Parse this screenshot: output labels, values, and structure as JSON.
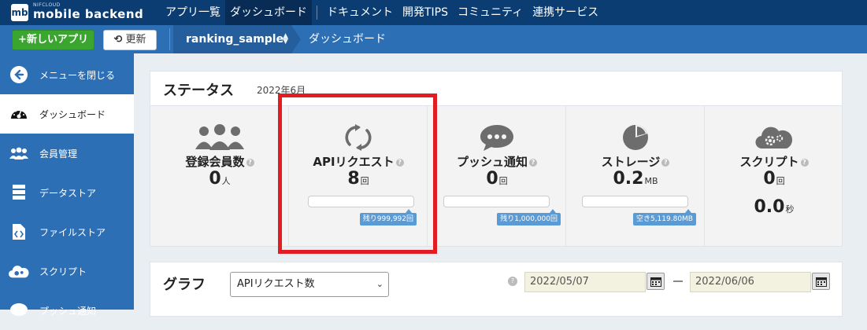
{
  "brand": {
    "small": "NIFCLOUD",
    "name": "mobile backend",
    "logo": "mb"
  },
  "topnav": {
    "items": [
      "アプリ一覧",
      "ダッシュボード",
      "ドキュメント",
      "開発TIPS",
      "コミュニティ",
      "連携サービス"
    ],
    "active_index": 1
  },
  "subbar": {
    "new_app_label": "+新しいアプリ",
    "refresh_label": "更新",
    "app_name": "ranking_sample",
    "breadcrumb": "ダッシュボード"
  },
  "sidebar": {
    "items": [
      {
        "label": "メニューを閉じる",
        "icon": "arrow-left-circle-icon"
      },
      {
        "label": "ダッシュボード",
        "icon": "gauge-icon",
        "active": true
      },
      {
        "label": "会員管理",
        "icon": "users-icon"
      },
      {
        "label": "データストア",
        "icon": "database-icon"
      },
      {
        "label": "ファイルストア",
        "icon": "file-code-icon"
      },
      {
        "label": "スクリプト",
        "icon": "cloud-gear-icon"
      },
      {
        "label": "プッシュ通知",
        "icon": "chat-icon"
      }
    ]
  },
  "status": {
    "title": "ステータス",
    "month": "2022年6月",
    "cards": [
      {
        "label": "登録会員数",
        "value": "0",
        "unit": "人",
        "icon": "users-icon"
      },
      {
        "label": "APIリクエスト",
        "value": "8",
        "unit": "回",
        "icon": "refresh-icon",
        "remaining": "残り999,992回",
        "usage_fraction": 0.0
      },
      {
        "label": "プッシュ通知",
        "value": "0",
        "unit": "回",
        "icon": "chat-bubble-icon",
        "remaining": "残り1,000,000回",
        "usage_fraction": 0.0
      },
      {
        "label": "ストレージ",
        "value": "0.2",
        "unit": "MB",
        "icon": "pie-chart-icon",
        "remaining": "空き5,119.80MB",
        "usage_fraction": 0.0
      },
      {
        "label": "スクリプト",
        "value": "0",
        "unit": "回",
        "value2": "0.0",
        "unit2": "秒",
        "icon": "cloud-gear-icon"
      }
    ]
  },
  "graph": {
    "title": "グラフ",
    "metric_selected": "APIリクエスト数",
    "date_from": "2022/05/07",
    "date_to": "2022/06/06"
  },
  "colors": {
    "topbar": "#0b3d73",
    "subbar": "#2d6fb5",
    "new_button": "#3aa62f",
    "highlight": "#e11d23",
    "badge": "#5b9bd5"
  }
}
